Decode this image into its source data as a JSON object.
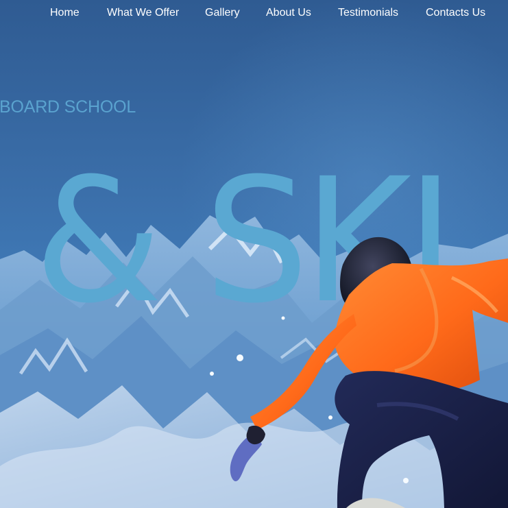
{
  "nav": {
    "items": [
      {
        "label": "Home"
      },
      {
        "label": "What We Offer"
      },
      {
        "label": "Gallery"
      },
      {
        "label": "About Us"
      },
      {
        "label": "Testimonials"
      },
      {
        "label": "Contacts Us"
      }
    ]
  },
  "hero": {
    "subtitle": "BOARD SCHOOL",
    "headline": "& SKI"
  },
  "colors": {
    "background": "#2f5f97",
    "nav_text": "#ffffff",
    "accent_blue": "#5aa8d2",
    "jacket": "#ff6a1a"
  },
  "icons": {
    "hero_image": "snowboarder-image",
    "background_image": "mountain-landscape"
  }
}
